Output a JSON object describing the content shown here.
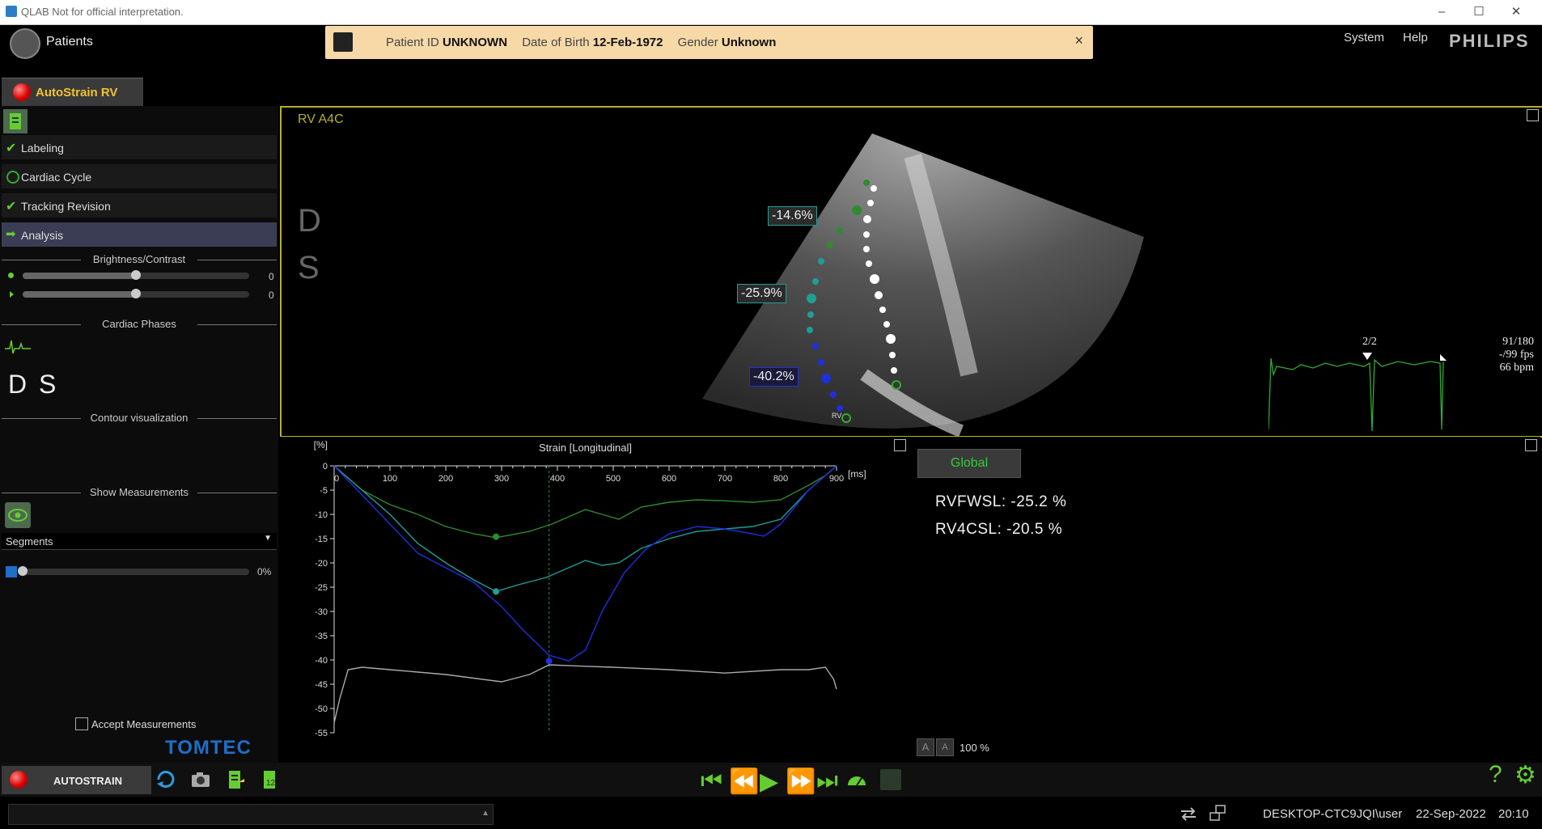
{
  "window": {
    "title": "QLAB Not for official interpretation."
  },
  "header": {
    "patients_label": "Patients",
    "banner": {
      "id_label": "Patient ID",
      "id_value": "UNKNOWN",
      "dob_label": "Date of Birth",
      "dob_value": "12-Feb-1972",
      "gender_label": "Gender",
      "gender_value": "Unknown",
      "close": "×"
    },
    "menu": [
      "System",
      "Help"
    ],
    "brand": "PHILIPS"
  },
  "tab": {
    "label": "AutoStrain RV"
  },
  "workflow": {
    "steps": [
      {
        "label": "Labeling",
        "state": "done"
      },
      {
        "label": "Cardiac Cycle",
        "state": "pending"
      },
      {
        "label": "Tracking Revision",
        "state": "done"
      },
      {
        "label": "Analysis",
        "state": "active"
      }
    ]
  },
  "brightness": {
    "title": "Brightness/Contrast",
    "brightness_value": "0",
    "contrast_value": "0",
    "brightness_level": 0.5,
    "contrast_level": 0.5
  },
  "phases": {
    "title": "Cardiac Phases",
    "d": "D",
    "s": "S"
  },
  "contour": {
    "title": "Contour visualization",
    "selected": "Segments",
    "opacity": "0%",
    "opacity_level": 0
  },
  "measurements": {
    "title": "Show Measurements",
    "accept_label": "Accept Measurements"
  },
  "logo": {
    "text": "TOMTEC"
  },
  "view": {
    "label": "RV A4C",
    "d": "D",
    "s": "S",
    "strain_labels": [
      "-14.6%",
      "-25.9%",
      "-40.2%"
    ],
    "ecg": {
      "beat": "2/2",
      "frame": "91/180",
      "fps": "-/99 fps",
      "bpm": "66 bpm"
    },
    "rv_marker": "RV"
  },
  "results": {
    "global_label": "Global",
    "rvfwsl": "RVFWSL: -25.2 %",
    "rv4csl": "RV4CSL: -20.5 %",
    "zoom": "100 %",
    "font_a": "A",
    "font_b": "A"
  },
  "chart_data": {
    "type": "line",
    "title": "Strain [Longitudinal]",
    "ylabel": "[%]",
    "xlabel": "[ms]",
    "xlim": [
      0,
      900
    ],
    "ylim": [
      -55,
      0
    ],
    "xticks": [
      100,
      200,
      300,
      400,
      500,
      600,
      700,
      800,
      900
    ],
    "yticks": [
      0,
      -5,
      -10,
      -15,
      -20,
      -25,
      -30,
      -35,
      -40,
      -45,
      -50,
      -55
    ],
    "marker_x": 385,
    "series": [
      {
        "color": "#2e8b2e",
        "x": [
          0,
          50,
          100,
          150,
          200,
          250,
          290,
          350,
          390,
          430,
          450,
          480,
          510,
          550,
          600,
          650,
          700,
          750,
          800,
          850,
          880,
          900
        ],
        "y": [
          0,
          -5,
          -8,
          -10,
          -12.5,
          -14,
          -14.8,
          -13.5,
          -12,
          -10,
          -9,
          -10,
          -11,
          -8.5,
          -7.5,
          -7,
          -7.2,
          -7.5,
          -7,
          -4,
          -2,
          0
        ],
        "point": [
          290,
          -14.6
        ]
      },
      {
        "color": "#1f9e96",
        "x": [
          0,
          50,
          100,
          150,
          200,
          250,
          290,
          330,
          380,
          420,
          450,
          480,
          510,
          550,
          600,
          650,
          700,
          750,
          800,
          850,
          880,
          900
        ],
        "y": [
          0,
          -5,
          -10,
          -16,
          -20,
          -23.5,
          -25.9,
          -24.5,
          -23,
          -21,
          -19.5,
          -20.5,
          -20,
          -17,
          -15,
          -13.5,
          -13,
          -12.5,
          -11,
          -5,
          -2,
          0
        ],
        "point": [
          290,
          -25.9
        ]
      },
      {
        "color": "#1e2fe0",
        "x": [
          0,
          50,
          100,
          150,
          200,
          250,
          300,
          340,
          385,
          420,
          450,
          480,
          520,
          560,
          600,
          650,
          700,
          750,
          770,
          800,
          850,
          880,
          900
        ],
        "y": [
          0,
          -6,
          -12,
          -18,
          -21,
          -24,
          -29,
          -34,
          -39,
          -40.2,
          -38,
          -30,
          -22,
          -17,
          -14,
          -12.5,
          -13,
          -14,
          -14.5,
          -12,
          -5,
          -2,
          0
        ],
        "point": [
          385,
          -40.2
        ]
      },
      {
        "color": "#aaaaaa",
        "x": [
          0,
          10,
          25,
          50,
          100,
          200,
          300,
          350,
          385,
          450,
          500,
          600,
          700,
          800,
          850,
          880,
          895,
          900
        ],
        "y": [
          -53,
          -48,
          -42,
          -41.5,
          -42,
          -43,
          -44.5,
          -43,
          -41,
          -41.3,
          -41.5,
          -42,
          -42.7,
          -42,
          -42,
          -41.5,
          -44,
          -46
        ]
      }
    ]
  },
  "toolbar": {
    "autostrain_label": "AUTOSTRAIN"
  },
  "status": {
    "host": "DESKTOP-CTC9JQI\\user",
    "date": "22-Sep-2022",
    "time": "20:10"
  },
  "colors": {
    "accent_green": "#66cc33",
    "frame_yellow": "#b7b02a",
    "brand_blue": "#1e6fc9"
  }
}
